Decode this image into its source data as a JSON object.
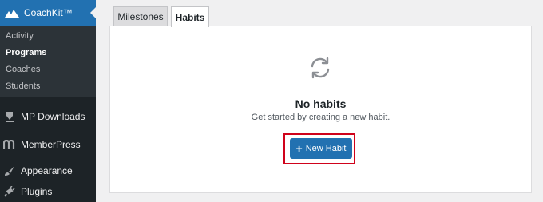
{
  "sidebar": {
    "brand": "CoachKit™",
    "submenu": [
      "Activity",
      "Programs",
      "Coaches",
      "Students"
    ],
    "active_submenu": "Programs",
    "menu": [
      {
        "label": "MP Downloads",
        "icon": "download-icon"
      },
      {
        "label": "MemberPress",
        "icon": "memberpress-icon"
      },
      {
        "label": "Appearance",
        "icon": "paintbrush-icon"
      },
      {
        "label": "Plugins",
        "icon": "plugin-icon"
      }
    ]
  },
  "tabs": [
    {
      "label": "Milestones",
      "active": false
    },
    {
      "label": "Habits",
      "active": true
    }
  ],
  "empty_state": {
    "icon": "refresh-icon",
    "title": "No habits",
    "subtitle": "Get started by creating a new habit.",
    "button_label": "New Habit"
  },
  "colors": {
    "accent": "#2271b1",
    "sidebar_bg": "#1d2327",
    "highlight": "#d0021b"
  }
}
